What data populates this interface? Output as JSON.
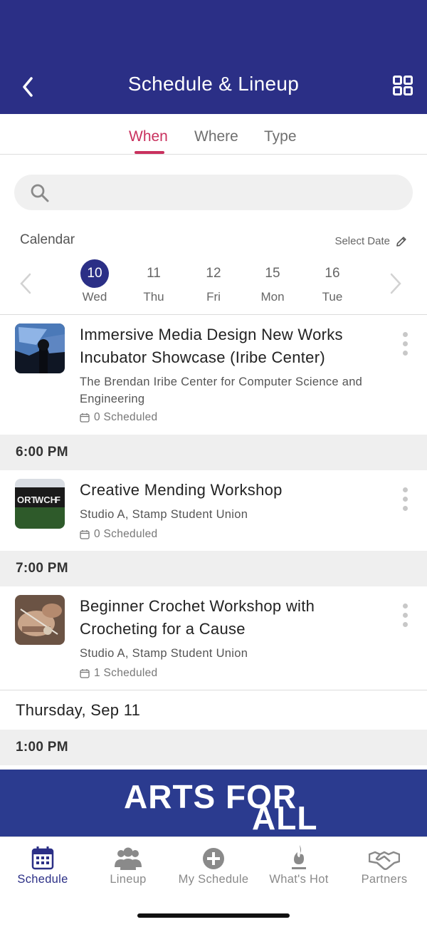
{
  "header": {
    "title": "Schedule & Lineup"
  },
  "tabs": [
    {
      "label": "When",
      "active": true
    },
    {
      "label": "Where",
      "active": false
    },
    {
      "label": "Type",
      "active": false
    }
  ],
  "search": {
    "placeholder": ""
  },
  "calendar": {
    "label": "Calendar",
    "select_date": "Select Date",
    "days": [
      {
        "num": "10",
        "dow": "Wed",
        "selected": true
      },
      {
        "num": "11",
        "dow": "Thu",
        "selected": false
      },
      {
        "num": "12",
        "dow": "Fri",
        "selected": false
      },
      {
        "num": "15",
        "dow": "Mon",
        "selected": false
      },
      {
        "num": "16",
        "dow": "Tue",
        "selected": false
      }
    ]
  },
  "events": [
    {
      "title": "Immersive Media Design New Works Incubator Showcase (Iribe Center)",
      "venue": "The Brendan Iribe Center for Computer Science and Engineering",
      "scheduled": "0 Scheduled"
    },
    {
      "title": "Creative Mending Workshop",
      "venue": "Studio A, Stamp Student Union",
      "scheduled": "0 Scheduled"
    },
    {
      "title": "Beginner Crochet Workshop with Crocheting for a Cause",
      "venue": "Studio A, Stamp Student Union",
      "scheduled": "1 Scheduled"
    }
  ],
  "time_headers": [
    "6:00 PM",
    "7:00 PM",
    "1:00 PM"
  ],
  "date_header": "Thursday, Sep 11",
  "banner": {
    "text_main": "ARTS FOR",
    "text_sub": "ALL"
  },
  "bottom_nav": [
    {
      "label": "Schedule",
      "icon": "calendar-icon",
      "active": true
    },
    {
      "label": "Lineup",
      "icon": "people-icon",
      "active": false
    },
    {
      "label": "My Schedule",
      "icon": "plus-circle-icon",
      "active": false
    },
    {
      "label": "What's Hot",
      "icon": "flame-icon",
      "active": false
    },
    {
      "label": "Partners",
      "icon": "handshake-icon",
      "active": false
    }
  ],
  "colors": {
    "primary": "#2b2f86",
    "accent": "#c9315e",
    "banner": "#2b3b8f"
  }
}
